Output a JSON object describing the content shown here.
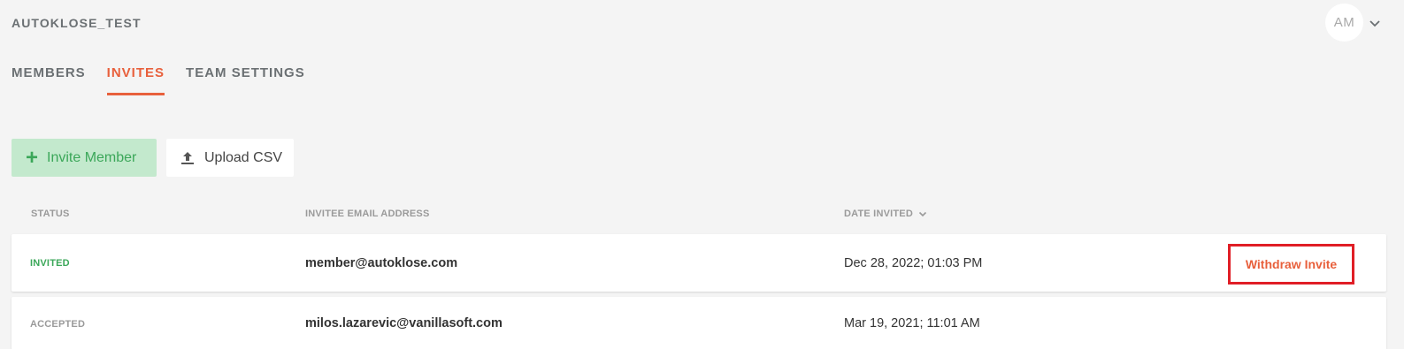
{
  "header": {
    "team_name": "AUTOKLOSE_TEST",
    "avatar_initials": "AM",
    "avatar_menu_icon": "chevron-down-icon"
  },
  "tabs": [
    {
      "label": "MEMBERS",
      "active": false
    },
    {
      "label": "INVITES",
      "active": true
    },
    {
      "label": "TEAM SETTINGS",
      "active": false
    }
  ],
  "actions": {
    "invite_label": "Invite Member",
    "invite_icon": "plus-icon",
    "upload_label": "Upload CSV",
    "upload_icon": "upload-icon"
  },
  "table": {
    "columns": {
      "status": "STATUS",
      "email": "INVITEE EMAIL ADDRESS",
      "date": "DATE INVITED"
    },
    "sort_icon": "chevron-down-icon",
    "rows": [
      {
        "status": "INVITED",
        "email": "member@autoklose.com",
        "date": "Dec 28, 2022; 01:03 PM",
        "action": "Withdraw Invite"
      },
      {
        "status": "ACCEPTED",
        "email": "milos.lazarevic@vanillasoft.com",
        "date": "Mar 19, 2021; 11:01 AM"
      }
    ]
  },
  "colors": {
    "accent": "#e8603c",
    "success": "#3ba759",
    "highlight_border": "#e01e26",
    "background": "#f4f4f4"
  }
}
